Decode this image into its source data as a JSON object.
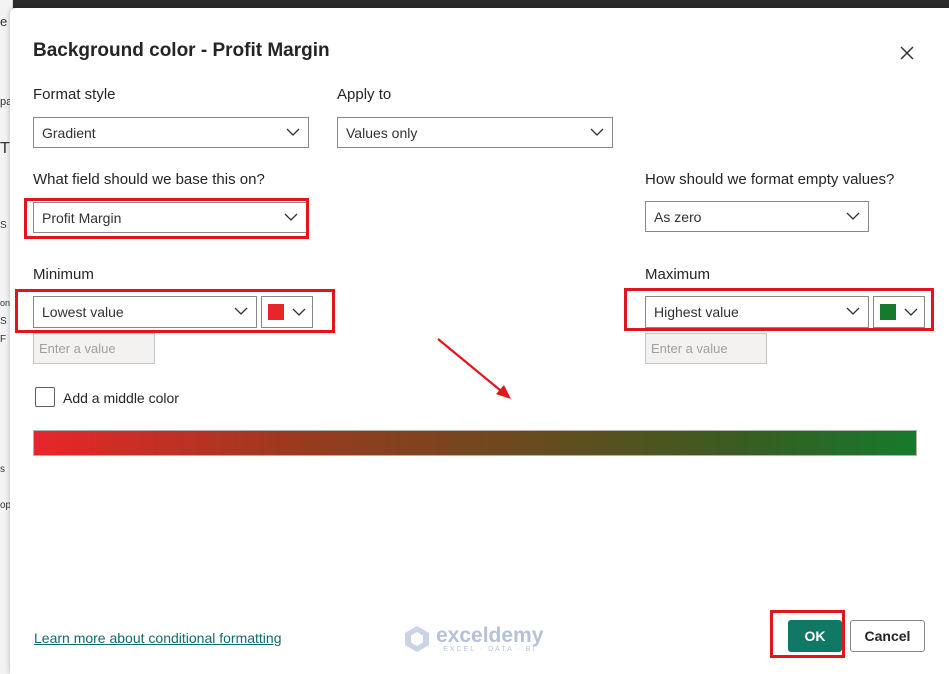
{
  "dialog": {
    "title": "Background color - Profit Margin",
    "close_icon": "close-icon"
  },
  "format_style": {
    "label": "Format style",
    "value": "Gradient"
  },
  "apply_to": {
    "label": "Apply to",
    "value": "Values only"
  },
  "base_field": {
    "label": "What field should we base this on?",
    "value": "Profit Margin"
  },
  "empty_values": {
    "label": "How should we format empty values?",
    "value": "As zero"
  },
  "minimum": {
    "label": "Minimum",
    "value": "Lowest value",
    "input_placeholder": "Enter a value",
    "color": "#e8262a"
  },
  "maximum": {
    "label": "Maximum",
    "value": "Highest value",
    "input_placeholder": "Enter a value",
    "color": "#167a2c"
  },
  "middle_color": {
    "label": "Add a middle color",
    "checked": false
  },
  "gradient": {
    "start": "#e8262a",
    "end": "#167a2c"
  },
  "footer": {
    "learn_more": "Learn more about conditional formatting",
    "ok": "OK",
    "cancel": "Cancel"
  },
  "watermark": {
    "name": "exceldemy",
    "sub": "EXCEL · DATA · BI"
  },
  "background": {
    "fragments": [
      "e",
      "pa",
      "T",
      "S",
      "on",
      "S",
      "F",
      "s",
      "op"
    ]
  },
  "colors": {
    "accent": "#117865",
    "highlight": "#e2151c",
    "link": "#116b6a"
  }
}
